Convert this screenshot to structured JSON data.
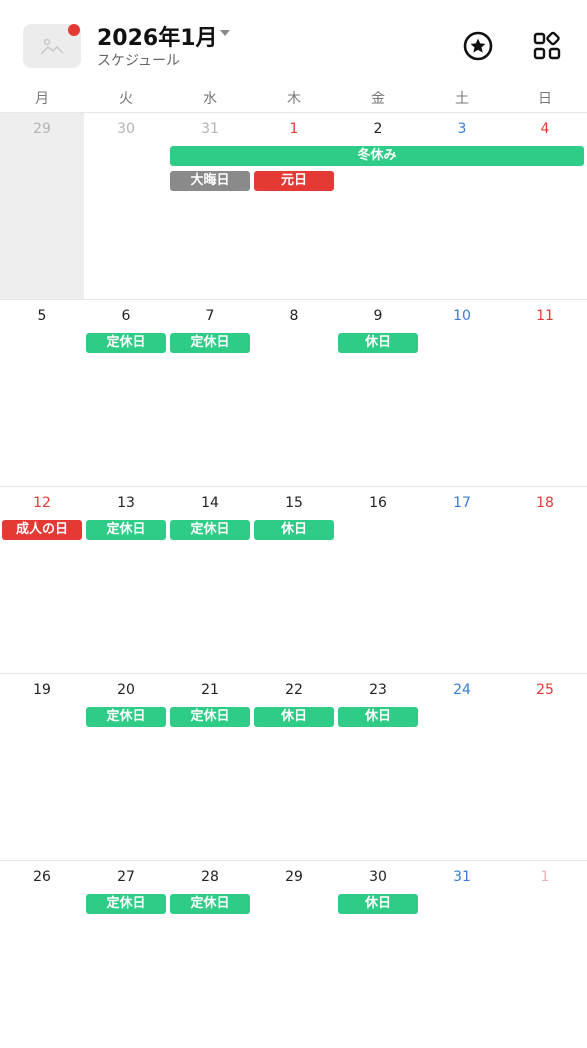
{
  "header": {
    "title": "2026年1月",
    "subtitle": "スケジュール",
    "avatar_icon": "image-placeholder-icon",
    "notification_dot_color": "#e53935",
    "favorite_icon": "star-circle-icon",
    "apps_icon": "apps-grid-icon"
  },
  "weekdays": [
    "月",
    "火",
    "水",
    "木",
    "金",
    "土",
    "日"
  ],
  "colors": {
    "accent_green": "#2ecc86",
    "holiday_red": "#e53935",
    "saturday_blue": "#3a7bd5",
    "neutral_gray": "#8a8a8a"
  },
  "weeks": [
    {
      "days": [
        "29",
        "30",
        "31",
        "1",
        "2",
        "3",
        "4"
      ]
    },
    {
      "days": [
        "5",
        "6",
        "7",
        "8",
        "9",
        "10",
        "11"
      ]
    },
    {
      "days": [
        "12",
        "13",
        "14",
        "15",
        "16",
        "17",
        "18"
      ]
    },
    {
      "days": [
        "19",
        "20",
        "21",
        "22",
        "23",
        "24",
        "25"
      ]
    },
    {
      "days": [
        "26",
        "27",
        "28",
        "29",
        "30",
        "31",
        "1"
      ]
    }
  ],
  "events": {
    "w0_winter_break": "冬休み",
    "w0_new_years_eve": "大晦日",
    "w0_new_years_day": "元日",
    "w1_tue": "定休日",
    "w1_wed": "定休日",
    "w1_fri": "休日",
    "w2_mon": "成人の日",
    "w2_tue": "定休日",
    "w2_wed": "定休日",
    "w2_thu": "休日",
    "w3_tue": "定休日",
    "w3_wed": "定休日",
    "w3_thu": "休日",
    "w3_fri": "休日",
    "w4_tue": "定休日",
    "w4_wed": "定休日",
    "w4_fri": "休日"
  }
}
